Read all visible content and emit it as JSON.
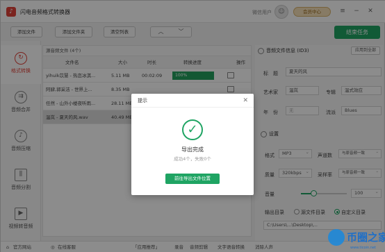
{
  "app": {
    "title": "闪电音频格式转换器",
    "user": "微信用户",
    "vip": "会员中心"
  },
  "toolbar": {
    "add_file": "添加文件",
    "add_folder": "添加文件夹",
    "clear_list": "清空列表",
    "end_task": "结束任务"
  },
  "sidebar": {
    "items": [
      {
        "label": "格式转换",
        "icon": "refresh-icon"
      },
      {
        "label": "音频合并",
        "icon": "merge-icon"
      },
      {
        "label": "音频压缩",
        "icon": "compress-icon"
      },
      {
        "label": "音频分割",
        "icon": "split-icon"
      },
      {
        "label": "视频转音频",
        "icon": "video-icon"
      }
    ]
  },
  "list": {
    "title": "源音频文件 (4个)",
    "columns": [
      "文件名",
      "大小",
      "时长",
      "转换进度",
      "操作"
    ],
    "rows": [
      {
        "name": "yihuik苡慧 - 热恋冰淇...",
        "size": "5.11 MB",
        "duration": "00:02:09",
        "progress": "100%"
      },
      {
        "name": "阿肆,郭采洁 - 世界上...",
        "size": "8.35 MB",
        "duration": "",
        "progress": ""
      },
      {
        "name": "任然 - 山外小楼夜听雨...",
        "size": "28.11 MB",
        "duration": "",
        "progress": ""
      },
      {
        "name": "温岚 - 夏天的风.wav",
        "size": "40.49 MB",
        "duration": "",
        "progress": ""
      }
    ]
  },
  "meta": {
    "section": "音频文件信息 (ID3)",
    "apply_all": "应用到全部",
    "title_label": "标　题",
    "title_value": "夏天的风",
    "artist_label": "艺术家",
    "artist_value": "温岚",
    "album_label": "专辑",
    "album_value": "温式效应",
    "year_label": "年　份",
    "year_value": "无",
    "genre_label": "流派",
    "genre_value": "Blues"
  },
  "settings": {
    "section": "设置",
    "format_label": "格式",
    "format_value": "MP3",
    "channels_label": "声道数",
    "channels_value": "与原音频一致",
    "quality_label": "质量",
    "quality_value": "320kbps",
    "samplerate_label": "采样率",
    "samplerate_value": "与原音频一致",
    "volume_label": "音量",
    "volume_value": "100",
    "volume_level": 0.27,
    "output_label": "输出目录",
    "output_source": "源文件目录",
    "output_custom": "自定义目录",
    "output_path": "C:\\Users\\...\\Desktop\\..."
  },
  "dialog": {
    "title": "提示",
    "heading": "导出完成",
    "sub": "成功4个，失败0个",
    "button": "前往导出文件位置"
  },
  "footer": {
    "items": [
      "官方网站",
      "在线客服",
      "「应用推荐」",
      "录音",
      "音频剪辑",
      "文字语音转换",
      "消除人声"
    ]
  },
  "watermark": {
    "text": "币圈之家",
    "url": "www.ticoin.net"
  },
  "colors": {
    "accent": "#1fa463",
    "brand": "#e0433a"
  }
}
